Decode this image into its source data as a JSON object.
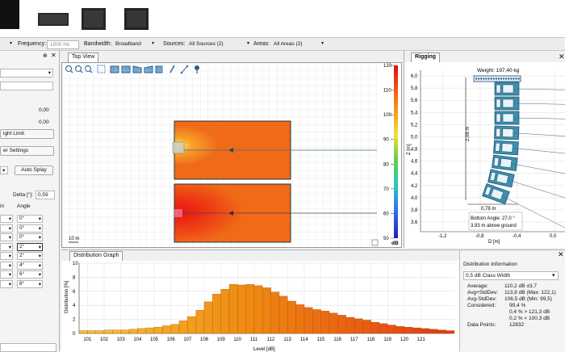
{
  "filterbar": {
    "frequency_label": "Frequency:",
    "frequency_value": "1000 Hz",
    "bandwidth_label": "Bandwidth:",
    "bandwidth_value": "Broadband",
    "sources_label": "Sources:",
    "sources_value": "All Sources (2)",
    "areas_label": "Areas:",
    "areas_value": "All Areas (2)"
  },
  "left_panel": {
    "pin_icon": "pin-icon",
    "value1": "0,00",
    "value2": "0,00",
    "height_limit_label": "ight Limit",
    "settings_label": "er Settings",
    "auto_splay_label": "Auto Splay",
    "delta_label": "Delta [°]:",
    "delta_value": "0,59",
    "col_in": "in",
    "col_angle": "Angle",
    "angles": [
      "0°",
      "0°",
      "0°",
      "2°",
      "2°",
      "4°",
      "6°",
      "8°"
    ]
  },
  "top_view": {
    "tab_label": "Top View",
    "scale_label": "10 m",
    "colorbar_ticks": [
      "120",
      "110",
      "100",
      "90",
      "80",
      "70",
      "60",
      "50"
    ],
    "colorbar_unit": "dB"
  },
  "rigging": {
    "tab_label": "Rigging",
    "weight_label": "Weight: 197,40 kg",
    "y_axis_label": "Z [m]",
    "y_ticks": [
      "6,0",
      "5,8",
      "5,6",
      "5,4",
      "5,2",
      "5,0",
      "4,8",
      "4,6",
      "4,4",
      "4,2",
      "4,0",
      "3,8",
      "3,6"
    ],
    "x_ticks": [
      "-1,2",
      "-0,8",
      "-0,4",
      "0,0",
      "0,4"
    ],
    "x_axis_label": "D [m]",
    "height_dim": "2,08 m",
    "width_dim": "0,78 m",
    "bottom_angle": "Bottom Angle: 27,0 °",
    "above_ground": "3,93 m above ground"
  },
  "dist_graph": {
    "tab_label": "Distribution Graph"
  },
  "chart_data": {
    "type": "bar",
    "xlabel": "Level [dB]",
    "ylabel": "Distribution [%]",
    "ylim": [
      0,
      10
    ],
    "y_ticks": [
      "10",
      "8",
      "6",
      "4",
      "2",
      "0"
    ],
    "x_ticks": [
      "101",
      "102",
      "103",
      "104",
      "105",
      "106",
      "107",
      "108",
      "109",
      "110",
      "111",
      "112",
      "113",
      "114",
      "115",
      "116",
      "117",
      "118",
      "119",
      "120",
      "121"
    ],
    "bin_width": 0.5,
    "bins_start": 100.5,
    "values": [
      0.4,
      0.4,
      0.4,
      0.5,
      0.5,
      0.5,
      0.6,
      0.7,
      0.8,
      0.9,
      1.1,
      1.3,
      1.8,
      2.4,
      3.3,
      4.5,
      5.6,
      6.3,
      7.0,
      6.9,
      7.0,
      6.8,
      6.5,
      5.9,
      5.3,
      4.6,
      4.1,
      3.7,
      3.4,
      3.2,
      2.9,
      2.6,
      2.3,
      2.1,
      1.9,
      1.6,
      1.4,
      1.2,
      1.0,
      0.9,
      0.8,
      0.7,
      0.6,
      0.5,
      0.4
    ],
    "colors": [
      "#f6c232",
      "#ef8a12",
      "#e23a12"
    ]
  },
  "dist_info": {
    "title": "Distribution Information",
    "class_width": "0,5 dB Class Width",
    "average_label": "Average:",
    "average_value": "110,2 dB ±3,7",
    "avg_plus_label": "Avg+StdDev:",
    "avg_plus_value": "113,9 dB (Max: 122,1)",
    "avg_minus_label": "Avg-StdDev:",
    "avg_minus_value": "106,5 dB (Min: 99,5)",
    "considered_label": "Considered:",
    "considered_value": "99,4 %",
    "above_value": "0,4 % > 121,3 dB",
    "below_value": "0,2 % < 100,3 dB",
    "points_label": "Data Points:",
    "points_value": "12832"
  }
}
